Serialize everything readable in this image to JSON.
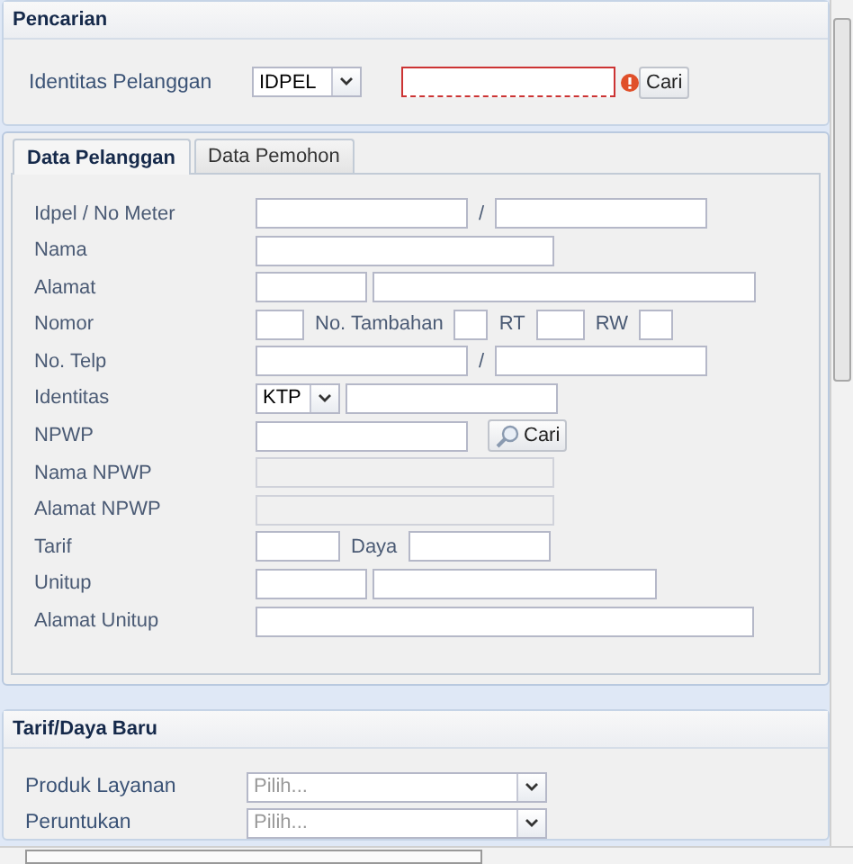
{
  "search_panel": {
    "title": "Pencarian",
    "label": "Identitas Pelanggan",
    "select": {
      "value": "IDPEL"
    },
    "input": {
      "invalid": true
    },
    "button": "Cari"
  },
  "tabs": [
    {
      "label": "Data Pelanggan",
      "selected": true
    },
    {
      "label": "Data Pemohon",
      "selected": false
    }
  ],
  "form_rows": [
    {
      "label": "Idpel / No Meter",
      "fields": [
        {
          "kind": "input"
        },
        {
          "kind": "text",
          "text": "/"
        },
        {
          "kind": "input"
        }
      ]
    },
    {
      "label": "Nama",
      "fields": [
        {
          "kind": "input"
        }
      ]
    },
    {
      "label": "Alamat",
      "fields": [
        {
          "kind": "input"
        },
        {
          "kind": "input"
        }
      ]
    },
    {
      "label": "Nomor",
      "fields": [
        {
          "kind": "input"
        },
        {
          "kind": "text",
          "text": "No. Tambahan"
        },
        {
          "kind": "input"
        },
        {
          "kind": "text",
          "text": "RT"
        },
        {
          "kind": "input"
        },
        {
          "kind": "text",
          "text": "RW"
        },
        {
          "kind": "input"
        }
      ]
    },
    {
      "label": "No. Telp",
      "fields": [
        {
          "kind": "input"
        },
        {
          "kind": "text",
          "text": "/"
        },
        {
          "kind": "input"
        }
      ]
    },
    {
      "label": "Identitas",
      "fields": [
        {
          "kind": "select",
          "value": "KTP"
        },
        {
          "kind": "input"
        }
      ]
    },
    {
      "label": "NPWP",
      "fields": [
        {
          "kind": "input"
        },
        {
          "kind": "button",
          "text": "Cari"
        }
      ]
    },
    {
      "label": "Nama NPWP",
      "fields": [
        {
          "kind": "input",
          "disabled": true
        }
      ]
    },
    {
      "label": "Alamat NPWP",
      "fields": [
        {
          "kind": "input",
          "disabled": true
        }
      ]
    },
    {
      "label": "Tarif",
      "fields": [
        {
          "kind": "input"
        },
        {
          "kind": "text",
          "text": "Daya"
        },
        {
          "kind": "input"
        }
      ]
    },
    {
      "label": "Unitup",
      "fields": [
        {
          "kind": "input"
        },
        {
          "kind": "input"
        }
      ]
    },
    {
      "label": "Alamat Unitup",
      "fields": [
        {
          "kind": "input"
        }
      ]
    }
  ],
  "tarif_panel": {
    "title": "Tarif/Daya Baru",
    "rows": [
      {
        "label": "Produk Layanan",
        "placeholder": "Pilih..."
      },
      {
        "label": "Peruntukan",
        "placeholder": "Pilih..."
      }
    ]
  }
}
